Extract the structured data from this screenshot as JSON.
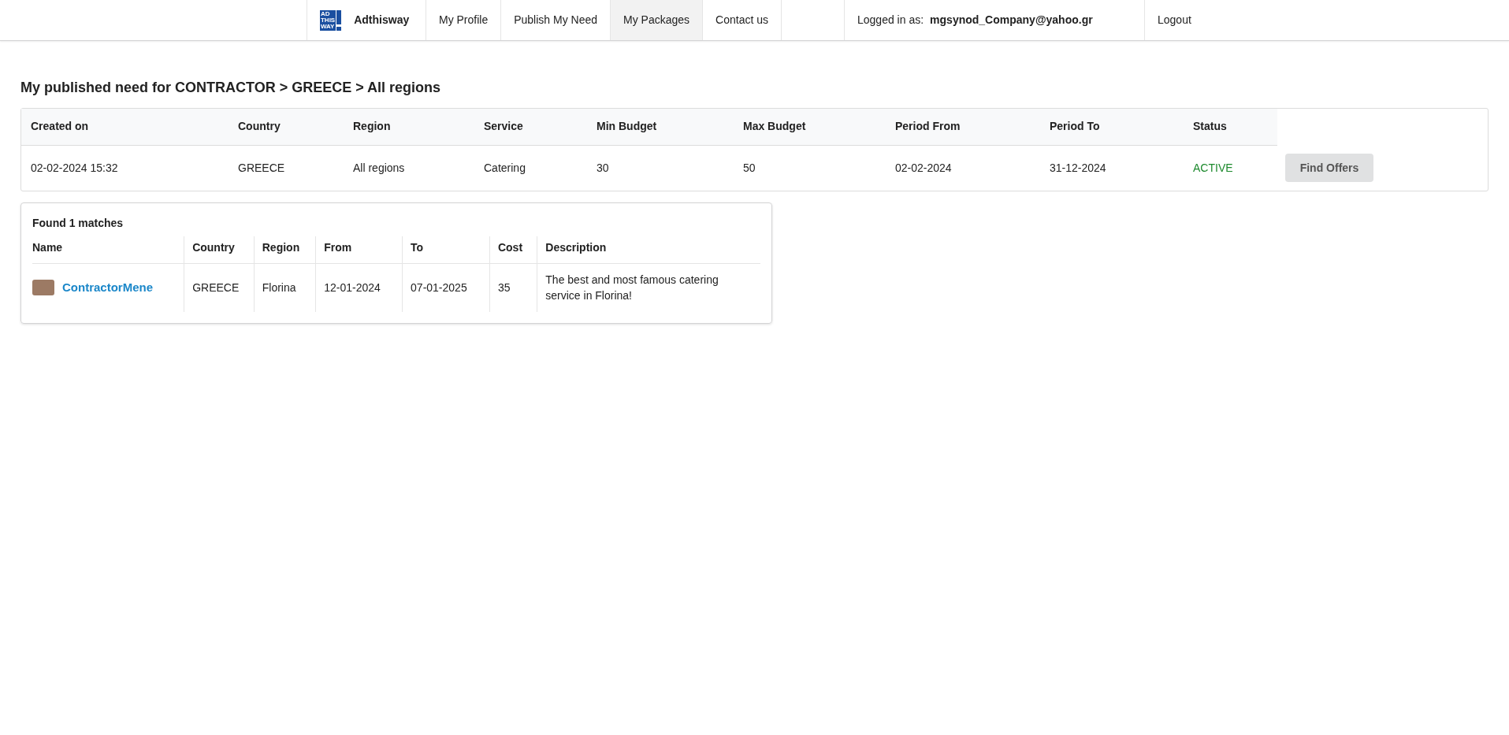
{
  "nav": {
    "logo_lines": [
      "AD",
      "THIS",
      "WAY"
    ],
    "brand": "Adthisway",
    "items": [
      {
        "label": "My Profile",
        "selected": false
      },
      {
        "label": "Publish My Need",
        "selected": false
      },
      {
        "label": "My Packages",
        "selected": true
      },
      {
        "label": "Contact us",
        "selected": false
      }
    ],
    "logged_in_label": "Logged in as:",
    "user": "mgsynod_Company@yahoo.gr",
    "logout": "Logout"
  },
  "title": "My published need for CONTRACTOR > GREECE > All regions",
  "need_table": {
    "columns": [
      "Created on",
      "Country",
      "Region",
      "Service",
      "Min Budget",
      "Max Budget",
      "Period From",
      "Period To",
      "Status"
    ],
    "rows": [
      {
        "cells": [
          "02-02-2024 15:32",
          "GREECE",
          "All regions",
          "Catering",
          "30",
          "50",
          "02-02-2024",
          "31-12-2024",
          "ACTIVE"
        ],
        "button": "Find Offers"
      }
    ]
  },
  "matches": {
    "heading": "Found 1 matches",
    "columns": [
      "Name",
      "Country",
      "Region",
      "From",
      "To",
      "Cost",
      "Description"
    ],
    "rows": [
      {
        "cells": [
          "ContractorMene",
          "GREECE",
          "Florina",
          "12-01-2024",
          "07-01-2025",
          "35",
          "The best and most famous catering service in Florina!"
        ]
      }
    ]
  }
}
